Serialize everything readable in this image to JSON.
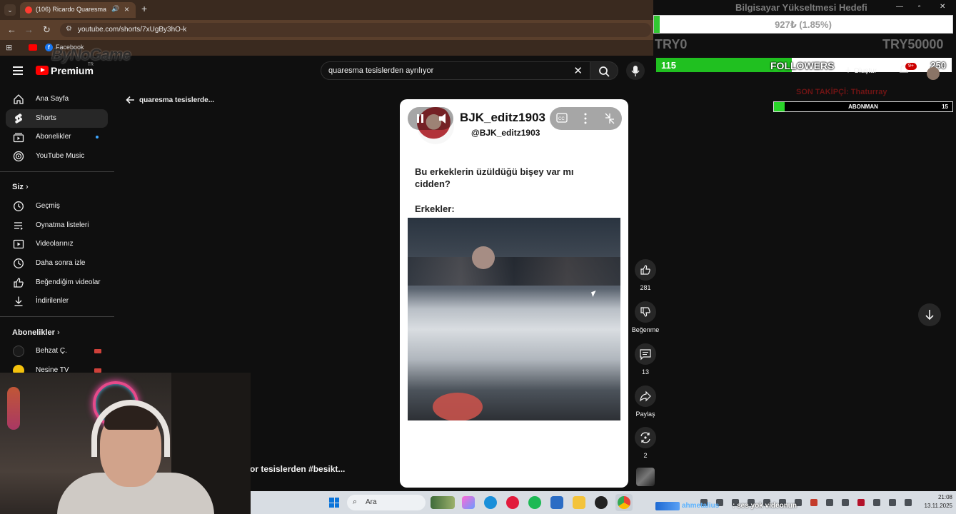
{
  "browser": {
    "tab_title": "(106) Ricardo Quaresma ay...",
    "url": "youtube.com/shorts/7xUgBy3hO-k",
    "bookmark_label": "Facebook"
  },
  "overlay_logo": "ByNoGame",
  "youtube": {
    "logo_text": "Premium",
    "logo_region": "TR",
    "search_value": "quaresma tesislerden ayrılıyor"
  },
  "sidebar": {
    "main": [
      {
        "label": "Ana Sayfa",
        "icon": "home-icon"
      },
      {
        "label": "Shorts",
        "icon": "shorts-icon",
        "active": true
      },
      {
        "label": "Abonelikler",
        "icon": "subscriptions-icon"
      },
      {
        "label": "YouTube Music",
        "icon": "music-icon"
      }
    ],
    "you_heading": "Siz",
    "you": [
      {
        "label": "Geçmiş",
        "icon": "history-icon"
      },
      {
        "label": "Oynatma listeleri",
        "icon": "playlists-icon"
      },
      {
        "label": "Videolarınız",
        "icon": "your-videos-icon"
      },
      {
        "label": "Daha sonra izle",
        "icon": "watch-later-icon"
      },
      {
        "label": "Beğendiğim videolar",
        "icon": "liked-icon"
      },
      {
        "label": "İndirilenler",
        "icon": "downloads-icon"
      }
    ],
    "subs_heading": "Abonelikler",
    "subs": [
      {
        "label": "Behzat Ç."
      },
      {
        "label": "Nesine TV"
      }
    ]
  },
  "back_label": "quaresma tesislerde...",
  "short": {
    "channel_name": "BJK_editz1903",
    "channel_handle": "@BJK_editz1903",
    "post_text": "Bu erkeklerin üzüldüğü bişey var mı cidden?",
    "post_text2": "Erkekler:",
    "hashtag_title": "or tesislerden  #besikt..."
  },
  "actions": {
    "like_count": "281",
    "dislike_label": "Beğenme",
    "comment_count": "13",
    "share_label": "Paylaş",
    "remix_count": "2"
  },
  "taskbar": {
    "search_placeholder": "Ara",
    "time": "21:08",
    "date": "13.11.2025"
  },
  "stream_overlay": {
    "goal_title": "Bilgisayar Yükseltmesi Hedefi",
    "goal_text": "927₺ (1.85%)",
    "goal_fraction": 0.0185,
    "goal_min": "TRY0",
    "goal_max": "TRY50000",
    "followers_current": "115",
    "followers_label": "FOLLOWERS",
    "followers_target": "250",
    "followers_fraction": 0.46,
    "create_label": "Oluştur",
    "notif_badge": "9+",
    "last_follower": "SON TAKİPÇİ: Thaturray",
    "sub_label": "ABONMAN",
    "sub_count": "15",
    "sub_fraction": 0.06,
    "chat_name": "ahmetalius",
    "chat_msg": ": ses yok videonun"
  },
  "colors": {
    "yt_red": "#ff0000",
    "goal_green": "#32c832",
    "sidebar_active": "#272727"
  }
}
